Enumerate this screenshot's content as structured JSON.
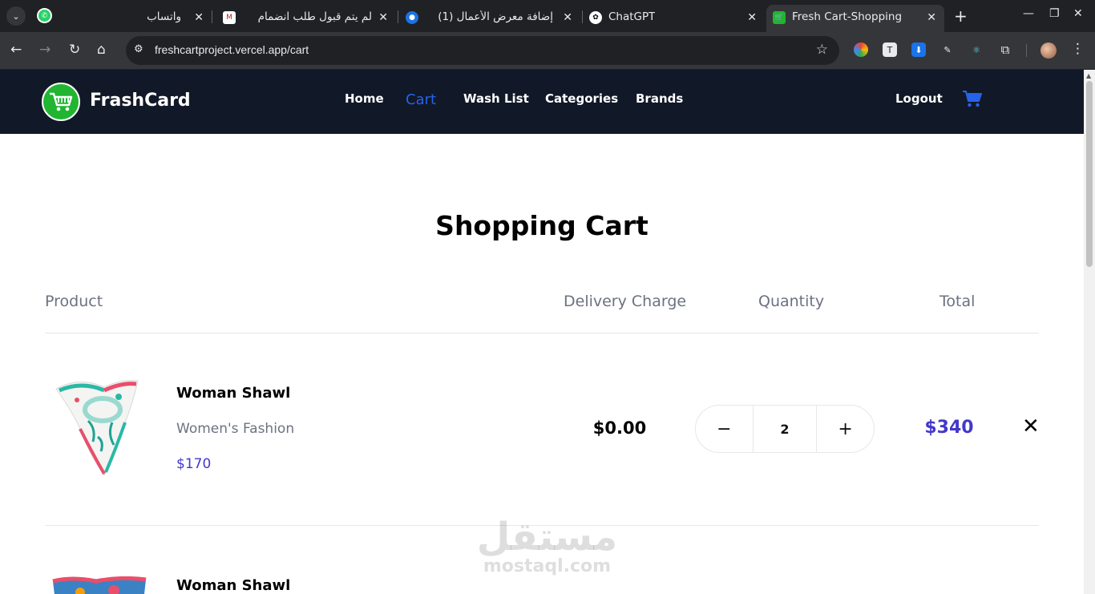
{
  "browser": {
    "tabs": [
      {
        "title": "واتساب",
        "favicon": "whatsapp-icon"
      },
      {
        "title": "لم يتم قبول طلب انضمام",
        "favicon": "gmail-icon"
      },
      {
        "title": "(1) إضافة معرض الأعمال",
        "favicon": "mostaql-icon"
      },
      {
        "title": "ChatGPT",
        "favicon": "chatgpt-icon"
      },
      {
        "title": "Fresh Cart-Shopping",
        "favicon": "freshcart-icon"
      }
    ],
    "url": "freshcartproject.vercel.app/cart"
  },
  "site": {
    "brand": "FrashCard",
    "nav": {
      "home": "Home",
      "cart": "Cart",
      "wishlist": "Wash List",
      "categories": "Categories",
      "brands": "Brands",
      "logout": "Logout"
    },
    "accent_color": "#2563eb",
    "nav_bg": "#111827"
  },
  "cart": {
    "title": "Shopping Cart",
    "headers": {
      "product": "Product",
      "delivery": "Delivery Charge",
      "quantity": "Quantity",
      "total": "Total"
    },
    "items": [
      {
        "name": "Woman Shawl",
        "category": "Women's Fashion",
        "price": "$170",
        "delivery": "$0.00",
        "quantity": "2",
        "total": "$340",
        "minus": "−",
        "plus": "+",
        "remove": "✕"
      },
      {
        "name": "Woman Shawl"
      }
    ]
  },
  "watermark": {
    "arabic": "مستقل",
    "latin": "mostaql.com"
  }
}
